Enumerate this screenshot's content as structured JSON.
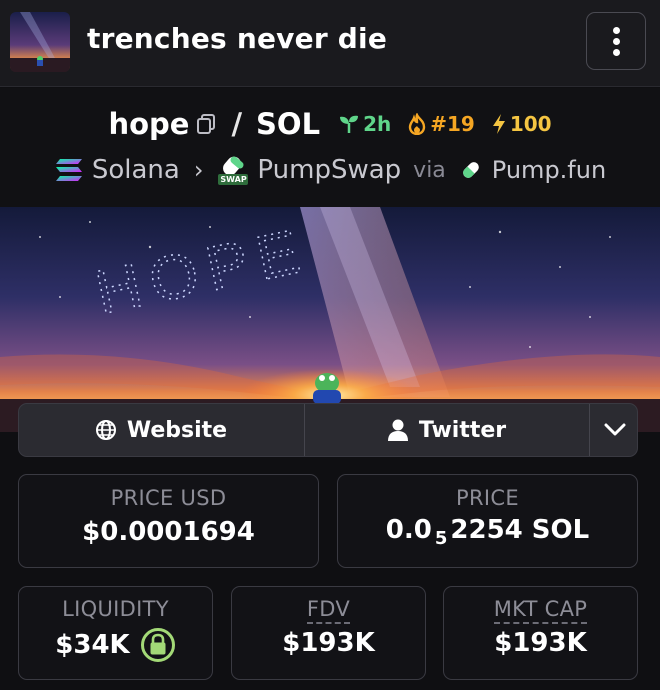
{
  "header": {
    "title": "trenches never die",
    "menu_icon": "kebab-menu-icon"
  },
  "pair": {
    "base_token": "hope",
    "quote_token": "SOL",
    "age": "2h",
    "rank": "#19",
    "boost": "100",
    "chain": "Solana",
    "dex": "PumpSwap",
    "dex_icon_text": "SWAP",
    "via_label": "via",
    "launchpad": "Pump.fun"
  },
  "banner": {
    "sky_text": "HOPE"
  },
  "links": {
    "website": "Website",
    "twitter": "Twitter"
  },
  "stats": {
    "price_usd_label": "PRICE USD",
    "price_usd": "$0.0001694",
    "price_label": "PRICE",
    "price_sol_prefix": "0.0",
    "price_sol_subscript": "5",
    "price_sol_suffix": "2254 SOL",
    "liquidity_label": "LIQUIDITY",
    "liquidity": "$34K",
    "fdv_label": "FDV",
    "fdv": "$193K",
    "mkt_cap_label": "MKT CAP",
    "mkt_cap": "$193K"
  },
  "colors": {
    "age_green": "#5fd58a",
    "rank_orange": "#f5a623",
    "boost_yellow": "#f5c542",
    "lock_green": "#a3d977"
  }
}
